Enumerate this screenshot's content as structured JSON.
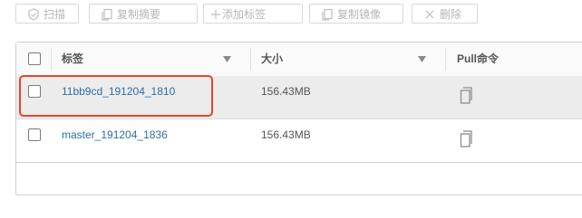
{
  "toolbar": {
    "scan_label": "扫描",
    "copy_digest_label": "复制摘要",
    "add_tag_label": "添加标签",
    "copy_image_label": "复制镜像",
    "delete_label": "删除"
  },
  "table": {
    "columns": [
      {
        "label": "标签"
      },
      {
        "label": "大小"
      },
      {
        "label": "Pull命令"
      }
    ],
    "rows": [
      {
        "tag": "11bb9cd_191204_1810",
        "size": "156.43MB"
      },
      {
        "tag": "master_191204_1836",
        "size": "156.43MB"
      }
    ]
  },
  "colors": {
    "link": "#2a6ea8",
    "highlight_border": "#e2452e",
    "row_selected_bg": "#ececec",
    "disabled_text": "#b6b6b6"
  },
  "icons": [
    "shield-icon",
    "copy-icon",
    "plus-icon",
    "copy-icon",
    "close-icon",
    "filter-icon",
    "clipboard-icon"
  ]
}
